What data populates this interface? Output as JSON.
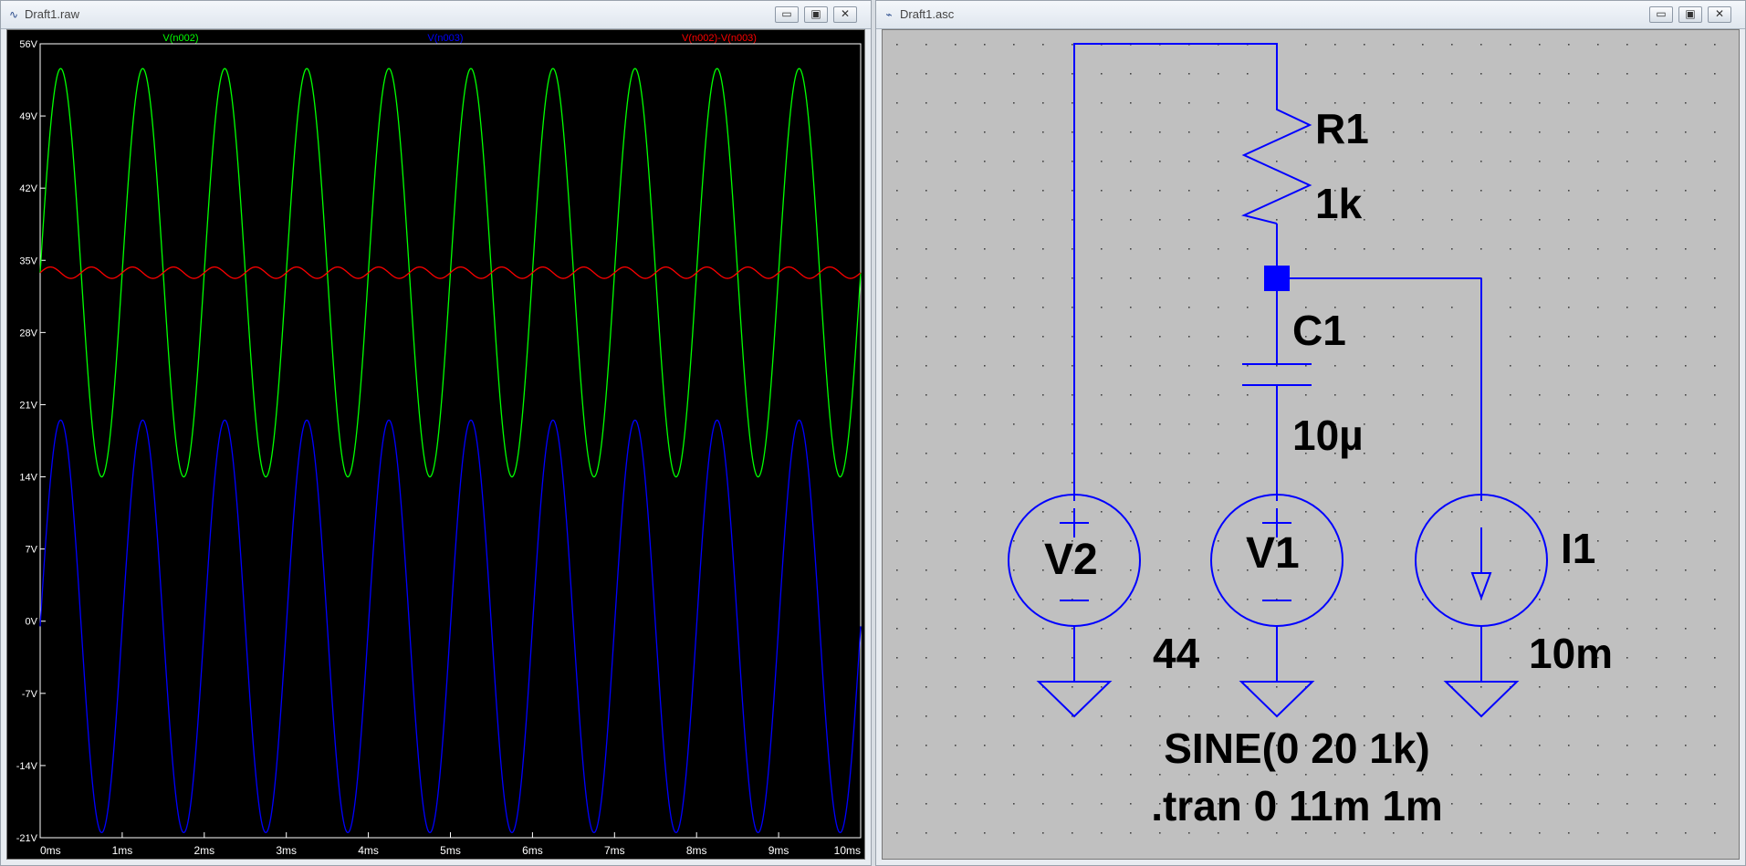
{
  "waveform_window": {
    "title": "Draft1.raw",
    "app_icon": "waveform-icon",
    "controls": {
      "minimize": "▭",
      "maximize": "▣",
      "close": "✕"
    }
  },
  "schematic_window": {
    "title": "Draft1.asc",
    "app_icon": "ltspice-icon",
    "controls": {
      "minimize": "▭",
      "maximize": "▣",
      "close": "✕"
    }
  },
  "chart_data": {
    "type": "line",
    "title": "",
    "xlabel": "",
    "ylabel": "",
    "xlim": [
      0,
      10
    ],
    "ylim": [
      -21,
      56
    ],
    "x_unit": "ms",
    "y_unit": "V",
    "x_ticks": [
      "0ms",
      "1ms",
      "2ms",
      "3ms",
      "4ms",
      "5ms",
      "6ms",
      "7ms",
      "8ms",
      "9ms",
      "10ms"
    ],
    "x_tick_values": [
      0,
      1,
      2,
      3,
      4,
      5,
      6,
      7,
      8,
      9,
      10
    ],
    "y_ticks": [
      "56V",
      "49V",
      "42V",
      "35V",
      "28V",
      "21V",
      "14V",
      "7V",
      "0V",
      "-7V",
      "-14V",
      "-21V"
    ],
    "y_tick_values": [
      56,
      49,
      42,
      35,
      28,
      21,
      14,
      7,
      0,
      -7,
      -14,
      -21
    ],
    "grid": false,
    "legend": "top",
    "series": [
      {
        "name": "V(n002)",
        "color": "#00ff00",
        "shape": "sine",
        "offset": 33.8,
        "amplitude": 19.8,
        "frequency_khz": 1,
        "phase_ms": 0,
        "x_range": [
          0,
          10
        ]
      },
      {
        "name": "V(n003)",
        "color": "#0000ff",
        "shape": "sine",
        "offset": -0.5,
        "amplitude": 20,
        "frequency_khz": 1,
        "phase_ms": 0,
        "x_range": [
          0,
          10
        ]
      },
      {
        "name": "V(n002)-V(n003)",
        "color": "#ff0000",
        "shape": "sine",
        "offset": 33.8,
        "amplitude": 0.55,
        "frequency_khz": 2,
        "phase_ms": 0,
        "x_range": [
          0,
          10
        ]
      }
    ]
  },
  "schematic": {
    "wire_color": "#0000ff",
    "labels": {
      "r1_name": "R1",
      "r1_value": "1k",
      "c1_name": "C1",
      "c1_value": "10µ",
      "v2_name": "V2",
      "v2_value": "44",
      "v1_name": "V1",
      "i1_name": "I1",
      "i1_value": "10m",
      "v1_source": "SINE(0 20 1k)",
      "directive": ".tran 0 11m 1m"
    }
  }
}
